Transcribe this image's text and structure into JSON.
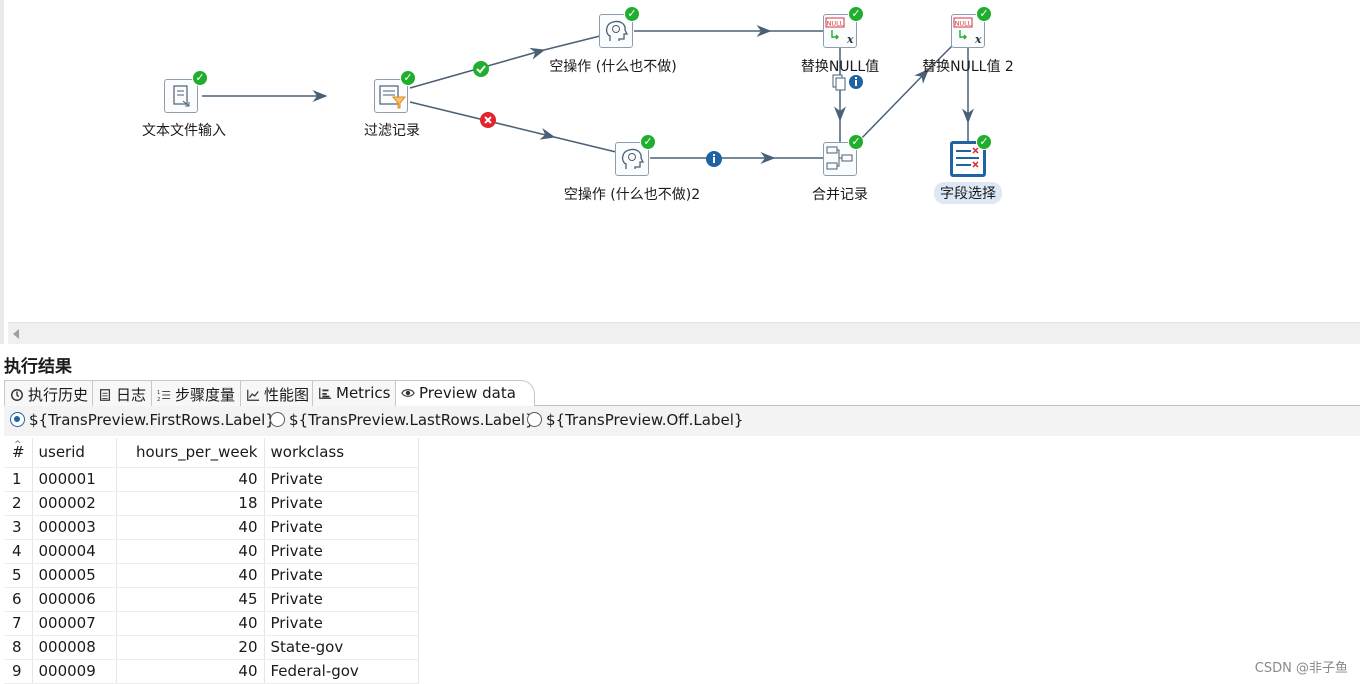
{
  "canvas": {
    "steps": [
      {
        "id": "text-input",
        "label": "文本文件输入",
        "icon": "text-file-input-icon"
      },
      {
        "id": "filter",
        "label": "过滤记录",
        "icon": "filter-rows-icon"
      },
      {
        "id": "dummy1",
        "label": "空操作 (什么也不做)",
        "icon": "dummy-step-icon"
      },
      {
        "id": "dummy2",
        "label": "空操作 (什么也不做)2",
        "icon": "dummy-step-icon"
      },
      {
        "id": "ifnull1",
        "label": "替换NULL值",
        "icon": "if-null-icon"
      },
      {
        "id": "ifnull2",
        "label": "替换NULL值 2",
        "icon": "if-null-icon"
      },
      {
        "id": "merge",
        "label": "合并记录",
        "icon": "merge-rows-icon"
      },
      {
        "id": "select",
        "label": "字段选择",
        "icon": "select-values-icon"
      }
    ],
    "null_badge_text": "NULL"
  },
  "results": {
    "title": "执行结果",
    "tabs": [
      {
        "label": "执行历史",
        "icon": "history-icon"
      },
      {
        "label": "日志",
        "icon": "log-icon"
      },
      {
        "label": "步骤度量",
        "icon": "step-metrics-icon"
      },
      {
        "label": "性能图",
        "icon": "performance-graph-icon"
      },
      {
        "label": "Metrics",
        "icon": "metrics-icon"
      },
      {
        "label": "Preview data",
        "icon": "eye-icon"
      }
    ],
    "radios": [
      {
        "label": "${TransPreview.FirstRows.Label}",
        "checked": true
      },
      {
        "label": "${TransPreview.LastRows.Label}",
        "checked": false
      },
      {
        "label": "${TransPreview.Off.Label}",
        "checked": false
      }
    ],
    "columns": [
      "#",
      "userid",
      "hours_per_week",
      "workclass"
    ],
    "rows": [
      [
        "1",
        "000001",
        "40",
        "Private"
      ],
      [
        "2",
        "000002",
        "18",
        "Private"
      ],
      [
        "3",
        "000003",
        "40",
        "Private"
      ],
      [
        "4",
        "000004",
        "40",
        "Private"
      ],
      [
        "5",
        "000005",
        "40",
        "Private"
      ],
      [
        "6",
        "000006",
        "45",
        "Private"
      ],
      [
        "7",
        "000007",
        "40",
        "Private"
      ],
      [
        "8",
        "000008",
        "20",
        "State-gov"
      ],
      [
        "9",
        "000009",
        "40",
        "Federal-gov"
      ]
    ]
  },
  "watermark": "CSDN @非子鱼",
  "colors": {
    "ok": "#1fae2e",
    "error": "#e0242f",
    "info": "#1f63a3",
    "hop": "#4a6076"
  }
}
